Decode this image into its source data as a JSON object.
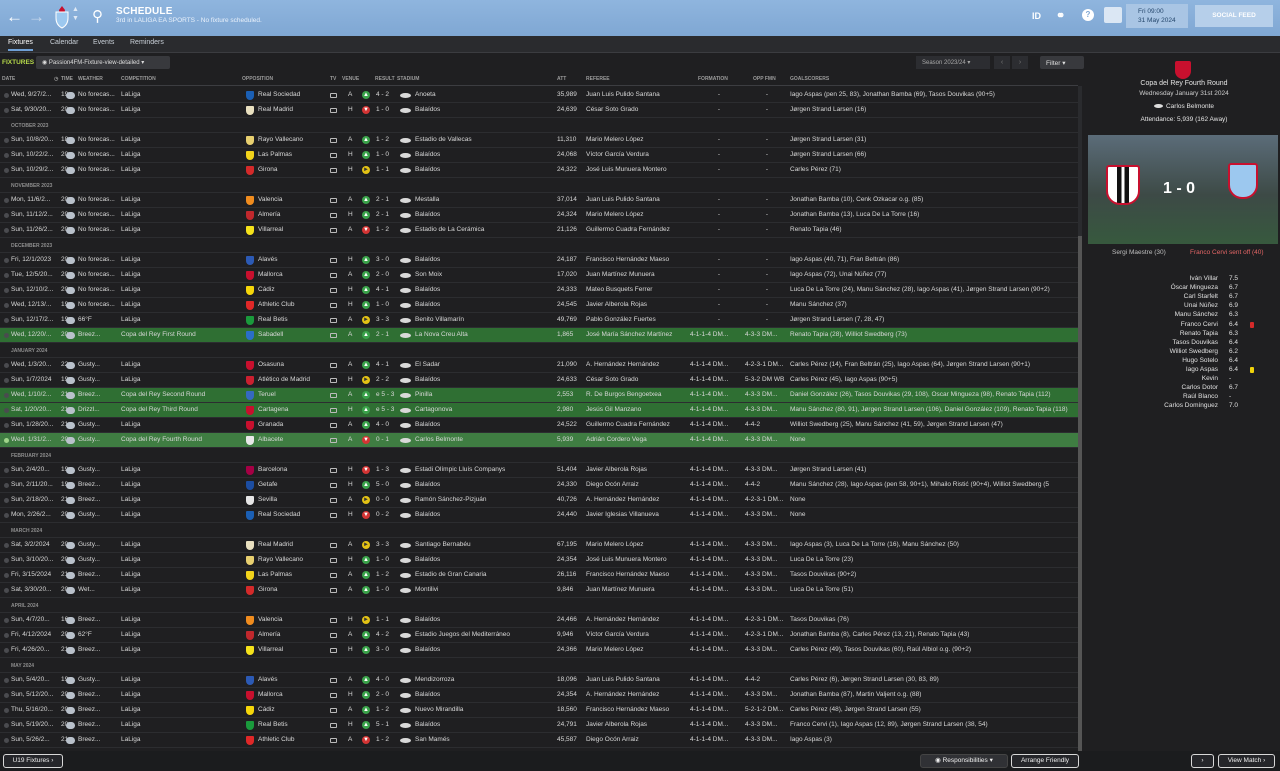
{
  "header": {
    "title": "SCHEDULE",
    "subtitle": "3rd in LALIGA EA SPORTS - No fixture scheduled.",
    "date_line1": "Fri 09:00",
    "date_line2": "31 May 2024",
    "social_feed": "SOCIAL FEED",
    "id_label": "ID"
  },
  "tabs": [
    "Fixtures",
    "Calendar",
    "Events",
    "Reminders"
  ],
  "toolbar": {
    "fixtures_label": "FIXTURES",
    "view": "Passion4FM-Fixture-view-detailed",
    "season": "Season 2023/24",
    "filter": "Filter"
  },
  "columns": {
    "date": "DATE",
    "time": "TIME",
    "weather": "WEATHER",
    "competition": "COMPETITION",
    "opposition": "OPPOSITION",
    "tv": "TV",
    "venue": "VENUE",
    "result": "RESULT",
    "stadium": "STADIUM",
    "att": "ATT",
    "referee": "REFEREE",
    "formation": "FORMATION",
    "opp_fmn": "OPP FMN",
    "goalscorers": "GOALSCORERS"
  },
  "rows": [
    {
      "date": "Wed, 9/27/2...",
      "time": "19:...",
      "weather": "No forecas...",
      "comp": "LaLiga",
      "opp": "Real Sociedad",
      "venue": "A",
      "res": "W",
      "score": "4 - 2",
      "stadium": "Anoeta",
      "att": "35,989",
      "ref": "Juan Luis Pulido Santana",
      "fmn": "-",
      "opp_fmn": "-",
      "scorers": "Iago Aspas (pen 25, 83), Jonathan Bamba (69), Tasos Douvikas (90+5)",
      "crest": "#1b5fb4"
    },
    {
      "date": "Sat, 9/30/20...",
      "time": "20:...",
      "weather": "No forecas...",
      "comp": "LaLiga",
      "opp": "Real Madrid",
      "venue": "H",
      "res": "L",
      "score": "1 - 0",
      "stadium": "Balaídos",
      "att": "24,639",
      "ref": "César Soto Grado",
      "fmn": "-",
      "opp_fmn": "-",
      "scorers": "Jørgen Strand Larsen (16)",
      "crest": "#e9e0c0"
    },
    {
      "section": "OCTOBER 2023"
    },
    {
      "date": "Sun, 10/8/20...",
      "time": "18:...",
      "weather": "No forecas...",
      "comp": "LaLiga",
      "opp": "Rayo Vallecano",
      "venue": "A",
      "res": "W",
      "score": "1 - 2",
      "stadium": "Estadio de Vallecas",
      "att": "11,310",
      "ref": "Mario Melero López",
      "fmn": "-",
      "opp_fmn": "-",
      "scorers": "Jørgen Strand Larsen (31)",
      "crest": "#e8d070"
    },
    {
      "date": "Sun, 10/22/2...",
      "time": "20:...",
      "weather": "No forecas...",
      "comp": "LaLiga",
      "opp": "Las Palmas",
      "venue": "H",
      "res": "W",
      "score": "1 - 0",
      "stadium": "Balaídos",
      "att": "24,068",
      "ref": "Víctor García Verdura",
      "fmn": "-",
      "opp_fmn": "-",
      "scorers": "Jørgen Strand Larsen (66)",
      "crest": "#f2d31b"
    },
    {
      "date": "Sun, 10/29/2...",
      "time": "20:...",
      "weather": "No forecas...",
      "comp": "LaLiga",
      "opp": "Girona",
      "venue": "H",
      "res": "D",
      "score": "1 - 1",
      "stadium": "Balaídos",
      "att": "24,322",
      "ref": "José Luis Munuera Montero",
      "fmn": "-",
      "opp_fmn": "-",
      "scorers": "Carles Pérez (71)",
      "crest": "#d42a2a"
    },
    {
      "section": "NOVEMBER 2023"
    },
    {
      "date": "Mon, 11/6/2...",
      "time": "20:...",
      "weather": "No forecas...",
      "comp": "LaLiga",
      "opp": "Valencia",
      "venue": "A",
      "res": "W",
      "score": "2 - 1",
      "stadium": "Mestalla",
      "att": "37,014",
      "ref": "Juan Luis Pulido Santana",
      "fmn": "-",
      "opp_fmn": "-",
      "scorers": "Jonathan Bamba (10), Cenk Özkacar o.g. (85)",
      "crest": "#f08c1e"
    },
    {
      "date": "Sun, 11/12/2...",
      "time": "20:...",
      "weather": "No forecas...",
      "comp": "LaLiga",
      "opp": "Almería",
      "venue": "H",
      "res": "W",
      "score": "2 - 1",
      "stadium": "Balaídos",
      "att": "24,324",
      "ref": "Mario Melero López",
      "fmn": "-",
      "opp_fmn": "-",
      "scorers": "Jonathan Bamba (13), Luca De La Torre (16)",
      "crest": "#c0282d"
    },
    {
      "date": "Sun, 11/26/2...",
      "time": "20:...",
      "weather": "No forecas...",
      "comp": "LaLiga",
      "opp": "Villarreal",
      "venue": "A",
      "res": "L",
      "score": "1 - 2",
      "stadium": "Estadio de La Cerámica",
      "att": "21,126",
      "ref": "Guillermo Cuadra Fernández",
      "fmn": "-",
      "opp_fmn": "-",
      "scorers": "Renato Tapia (46)",
      "crest": "#f5e21b"
    },
    {
      "section": "DECEMBER 2023"
    },
    {
      "date": "Fri, 12/1/2023",
      "time": "20:...",
      "weather": "No forecas...",
      "comp": "LaLiga",
      "opp": "Alavés",
      "venue": "H",
      "res": "W",
      "score": "3 - 0",
      "stadium": "Balaídos",
      "att": "24,187",
      "ref": "Francisco Hernández Maeso",
      "fmn": "-",
      "opp_fmn": "-",
      "scorers": "Iago Aspas (40, 71), Fran Beltrán (86)",
      "crest": "#2c5ab5"
    },
    {
      "date": "Tue, 12/5/20...",
      "time": "20:...",
      "weather": "No forecas...",
      "comp": "LaLiga",
      "opp": "Mallorca",
      "venue": "A",
      "res": "W",
      "score": "2 - 0",
      "stadium": "Son Moix",
      "att": "17,020",
      "ref": "Juan Martínez Munuera",
      "fmn": "-",
      "opp_fmn": "-",
      "scorers": "Iago Aspas (72), Unai Núñez (77)",
      "crest": "#c8102e"
    },
    {
      "date": "Sun, 12/10/2...",
      "time": "20:...",
      "weather": "No forecas...",
      "comp": "LaLiga",
      "opp": "Cádiz",
      "venue": "H",
      "res": "W",
      "score": "4 - 1",
      "stadium": "Balaídos",
      "att": "24,333",
      "ref": "Mateo Busquets Ferrer",
      "fmn": "-",
      "opp_fmn": "-",
      "scorers": "Luca De La Torre (24), Manu Sánchez (28), Iago Aspas (41), Jørgen Strand Larsen (90+2)",
      "crest": "#f5d60a"
    },
    {
      "date": "Wed, 12/13/...",
      "time": "19:...",
      "weather": "No forecas...",
      "comp": "LaLiga",
      "opp": "Athletic Club",
      "venue": "H",
      "res": "W",
      "score": "1 - 0",
      "stadium": "Balaídos",
      "att": "24,545",
      "ref": "Javier Alberola Rojas",
      "fmn": "-",
      "opp_fmn": "-",
      "scorers": "Manu Sánchez (37)",
      "crest": "#e02828"
    },
    {
      "date": "Sun, 12/17/2...",
      "time": "19:...",
      "weather": "66°F",
      "comp": "LaLiga",
      "opp": "Real Betis",
      "venue": "A",
      "res": "D",
      "score": "3 - 3",
      "stadium": "Benito Villamarín",
      "att": "49,769",
      "ref": "Pablo González Fuertes",
      "fmn": "-",
      "opp_fmn": "-",
      "scorers": "Jørgen Strand Larsen (7, 28, 47)",
      "crest": "#1a9a3c"
    },
    {
      "date": "Wed, 12/20/...",
      "time": "20:...",
      "weather": "Breez...",
      "comp": "Copa del Rey First Round",
      "opp": "Sabadell",
      "venue": "A",
      "res": "W",
      "score": "2 - 1",
      "stadium": "La Nova Creu Alta",
      "att": "1,865",
      "ref": "José María Sánchez Martínez",
      "fmn": "4-1-1-4 DM...",
      "opp_fmn": "4-3-3 DM...",
      "scorers": "Renato Tapia (28), Williot Swedberg (73)",
      "crest": "#2a6ec9",
      "cup": true
    },
    {
      "section": "JANUARY 2024"
    },
    {
      "date": "Wed, 1/3/20...",
      "time": "22:...",
      "weather": "Gusty...",
      "comp": "LaLiga",
      "opp": "Osasuna",
      "venue": "A",
      "res": "W",
      "score": "4 - 1",
      "stadium": "El Sadar",
      "att": "21,090",
      "ref": "A. Hernández Hernández",
      "fmn": "4-1-1-4 DM...",
      "opp_fmn": "4-2-3-1 DM...",
      "scorers": "Carles Pérez (14), Fran Beltrán (25), Iago Aspas (64), Jørgen Strand Larsen (90+1)",
      "crest": "#c8102e"
    },
    {
      "date": "Sun, 1/7/2024",
      "time": "19:...",
      "weather": "Gusty...",
      "comp": "LaLiga",
      "opp": "Atlético de Madrid",
      "venue": "H",
      "res": "D",
      "score": "2 - 2",
      "stadium": "Balaídos",
      "att": "24,633",
      "ref": "César Soto Grado",
      "fmn": "4-1-1-4 DM...",
      "opp_fmn": "5-3-2 DM WB",
      "scorers": "Carles Pérez (45), Iago Aspas (90+5)",
      "crest": "#cb2030"
    },
    {
      "date": "Wed, 1/10/2...",
      "time": "21:...",
      "weather": "Breez...",
      "comp": "Copa del Rey Second Round",
      "opp": "Teruel",
      "venue": "A",
      "res": "W",
      "score": "e 5 - 3",
      "stadium": "Pinilla",
      "att": "2,553",
      "ref": "R. De Burgos Bengoetxea",
      "fmn": "4-1-1-4 DM...",
      "opp_fmn": "4-3-3 DM...",
      "scorers": "Daniel González (26), Tasos Douvikas (29, 108), Óscar Mingueza (98), Renato Tapia (112)",
      "crest": "#3569c0",
      "cup": true
    },
    {
      "date": "Sat, 1/20/20...",
      "time": "21:...",
      "weather": "Drizzl...",
      "comp": "Copa del Rey Third Round",
      "opp": "Cartagena",
      "venue": "H",
      "res": "W",
      "score": "e 5 - 3",
      "stadium": "Cartagonova",
      "att": "2,980",
      "ref": "Jesús Gil Manzano",
      "fmn": "4-1-1-4 DM...",
      "opp_fmn": "4-3-3 DM...",
      "scorers": "Manu Sánchez (80, 91), Jørgen Strand Larsen (106), Daniel González (109), Renato Tapia (118)",
      "crest": "#c8102e",
      "cup": true
    },
    {
      "date": "Sun, 1/28/20...",
      "time": "21:...",
      "weather": "Gusty...",
      "comp": "LaLiga",
      "opp": "Granada",
      "venue": "A",
      "res": "W",
      "score": "4 - 0",
      "stadium": "Balaídos",
      "att": "24,522",
      "ref": "Guillermo Cuadra Fernández",
      "fmn": "4-1-1-4 DM...",
      "opp_fmn": "4-4-2",
      "scorers": "Williot Swedberg (25), Manu Sánchez (41, 59), Jørgen Strand Larsen (47)",
      "crest": "#c8102e"
    },
    {
      "date": "Wed, 1/31/2...",
      "time": "20:...",
      "weather": "Gusty...",
      "comp": "Copa del Rey Fourth Round",
      "opp": "Albacete",
      "venue": "A",
      "res": "L",
      "score": "0 - 1",
      "stadium": "Carlos Belmonte",
      "att": "5,939",
      "ref": "Adrián Cordero Vega",
      "fmn": "4-1-1-4 DM...",
      "opp_fmn": "4-3-3 DM...",
      "scorers": "None",
      "crest": "#e8e8e8",
      "cup": true,
      "selected": true
    },
    {
      "section": "FEBRUARY 2024"
    },
    {
      "date": "Sun, 2/4/20...",
      "time": "19:...",
      "weather": "Gusty...",
      "comp": "LaLiga",
      "opp": "Barcelona",
      "venue": "H",
      "res": "L",
      "score": "1 - 3",
      "stadium": "Estadi Olímpic Lluís Companys",
      "att": "51,404",
      "ref": "Javier Alberola Rojas",
      "fmn": "4-1-1-4 DM...",
      "opp_fmn": "4-3-3 DM...",
      "scorers": "Jørgen Strand Larsen (41)",
      "crest": "#a50044"
    },
    {
      "date": "Sun, 2/11/20...",
      "time": "19:...",
      "weather": "Breez...",
      "comp": "LaLiga",
      "opp": "Getafe",
      "venue": "H",
      "res": "W",
      "score": "5 - 0",
      "stadium": "Balaídos",
      "att": "24,330",
      "ref": "Diego Ocón Arraiz",
      "fmn": "4-1-1-4 DM...",
      "opp_fmn": "4-4-2",
      "scorers": "Manu Sánchez (28), Iago Aspas (pen 58, 90+1), Mihailo Ristić (90+4), Williot Swedberg (5",
      "crest": "#1c4da1"
    },
    {
      "date": "Sun, 2/18/20...",
      "time": "21:...",
      "weather": "Breez...",
      "comp": "LaLiga",
      "opp": "Sevilla",
      "venue": "A",
      "res": "D",
      "score": "0 - 0",
      "stadium": "Ramón Sánchez-Pizjuán",
      "att": "40,726",
      "ref": "A. Hernández Hernández",
      "fmn": "4-1-1-4 DM...",
      "opp_fmn": "4-2-3-1 DM...",
      "scorers": "None",
      "crest": "#e6e6e6"
    },
    {
      "date": "Mon, 2/26/2...",
      "time": "20:...",
      "weather": "Gusty...",
      "comp": "LaLiga",
      "opp": "Real Sociedad",
      "venue": "H",
      "res": "L",
      "score": "0 - 2",
      "stadium": "Balaídos",
      "att": "24,440",
      "ref": "Javier Iglesias Villanueva",
      "fmn": "4-1-1-4 DM...",
      "opp_fmn": "4-3-3 DM...",
      "scorers": "None",
      "crest": "#1b5fb4"
    },
    {
      "section": "MARCH 2024"
    },
    {
      "date": "Sat, 3/2/2024",
      "time": "20:...",
      "weather": "Gusty...",
      "comp": "LaLiga",
      "opp": "Real Madrid",
      "venue": "A",
      "res": "D",
      "score": "3 - 3",
      "stadium": "Santiago Bernabéu",
      "att": "67,195",
      "ref": "Mario Melero López",
      "fmn": "4-1-1-4 DM...",
      "opp_fmn": "4-3-3 DM...",
      "scorers": "Iago Aspas (3), Luca De La Torre (16), Manu Sánchez (50)",
      "crest": "#e9e0c0"
    },
    {
      "date": "Sun, 3/10/20...",
      "time": "20:...",
      "weather": "Gusty...",
      "comp": "LaLiga",
      "opp": "Rayo Vallecano",
      "venue": "H",
      "res": "W",
      "score": "1 - 0",
      "stadium": "Balaídos",
      "att": "24,354",
      "ref": "José Luis Munuera Montero",
      "fmn": "4-1-1-4 DM...",
      "opp_fmn": "4-3-3 DM...",
      "scorers": "Luca De La Torre (23)",
      "crest": "#e8d070"
    },
    {
      "date": "Fri, 3/15/2024",
      "time": "21:...",
      "weather": "Breez...",
      "comp": "LaLiga",
      "opp": "Las Palmas",
      "venue": "A",
      "res": "W",
      "score": "1 - 2",
      "stadium": "Estadio de Gran Canaria",
      "att": "26,116",
      "ref": "Francisco Hernández Maeso",
      "fmn": "4-1-1-4 DM...",
      "opp_fmn": "4-3-3 DM...",
      "scorers": "Tasos Douvikas (90+2)",
      "crest": "#f2d31b"
    },
    {
      "date": "Sat, 3/30/20...",
      "time": "20:...",
      "weather": "Wet...",
      "comp": "LaLiga",
      "opp": "Girona",
      "venue": "A",
      "res": "W",
      "score": "1 - 0",
      "stadium": "Montilivi",
      "att": "9,846",
      "ref": "Juan Martínez Munuera",
      "fmn": "4-1-1-4 DM...",
      "opp_fmn": "4-3-3 DM...",
      "scorers": "Luca De La Torre (51)",
      "crest": "#d42a2a"
    },
    {
      "section": "APRIL 2024"
    },
    {
      "date": "Sun, 4/7/20...",
      "time": "16:...",
      "weather": "Breez...",
      "comp": "LaLiga",
      "opp": "Valencia",
      "venue": "H",
      "res": "D",
      "score": "1 - 1",
      "stadium": "Balaídos",
      "att": "24,466",
      "ref": "A. Hernández Hernández",
      "fmn": "4-1-1-4 DM...",
      "opp_fmn": "4-2-3-1 DM...",
      "scorers": "Tasos Douvikas (76)",
      "crest": "#f08c1e"
    },
    {
      "date": "Fri, 4/12/2024",
      "time": "20:...",
      "weather": "62°F",
      "comp": "LaLiga",
      "opp": "Almería",
      "venue": "A",
      "res": "W",
      "score": "4 - 2",
      "stadium": "Estadio Juegos del Mediterráneo",
      "att": "9,946",
      "ref": "Víctor García Verdura",
      "fmn": "4-1-1-4 DM...",
      "opp_fmn": "4-2-3-1 DM...",
      "scorers": "Jonathan Bamba (8), Carles Pérez (13, 21), Renato Tapia (43)",
      "crest": "#c0282d"
    },
    {
      "date": "Fri, 4/26/20...",
      "time": "21:...",
      "weather": "Breez...",
      "comp": "LaLiga",
      "opp": "Villarreal",
      "venue": "H",
      "res": "W",
      "score": "3 - 0",
      "stadium": "Balaídos",
      "att": "24,366",
      "ref": "Mario Melero López",
      "fmn": "4-1-1-4 DM...",
      "opp_fmn": "4-3-3 DM...",
      "scorers": "Carles Pérez (49), Tasos Douvikas (60), Raúl Albiol o.g. (90+2)",
      "crest": "#f5e21b"
    },
    {
      "section": "MAY 2024"
    },
    {
      "date": "Sun, 5/4/20...",
      "time": "19:...",
      "weather": "Gusty...",
      "comp": "LaLiga",
      "opp": "Alavés",
      "venue": "A",
      "res": "W",
      "score": "4 - 0",
      "stadium": "Mendizorroza",
      "att": "18,096",
      "ref": "Juan Luis Pulido Santana",
      "fmn": "4-1-1-4 DM...",
      "opp_fmn": "4-4-2",
      "scorers": "Carles Pérez (6), Jørgen Strand Larsen (30, 83, 89)",
      "crest": "#2c5ab5"
    },
    {
      "date": "Sun, 5/12/20...",
      "time": "20:...",
      "weather": "Breez...",
      "comp": "LaLiga",
      "opp": "Mallorca",
      "venue": "H",
      "res": "W",
      "score": "2 - 0",
      "stadium": "Balaídos",
      "att": "24,354",
      "ref": "A. Hernández Hernández",
      "fmn": "4-1-1-4 DM...",
      "opp_fmn": "4-3-3 DM...",
      "scorers": "Jonathan Bamba (87), Martin Valjent o.g. (88)",
      "crest": "#c8102e"
    },
    {
      "date": "Thu, 5/16/20...",
      "time": "20:...",
      "weather": "Breez...",
      "comp": "LaLiga",
      "opp": "Cádiz",
      "venue": "A",
      "res": "W",
      "score": "1 - 2",
      "stadium": "Nuevo Mirandilla",
      "att": "18,560",
      "ref": "Francisco Hernández Maeso",
      "fmn": "4-1-1-4 DM...",
      "opp_fmn": "5-2-1-2 DM...",
      "scorers": "Carles Pérez (48), Jørgen Strand Larsen (55)",
      "crest": "#f5d60a"
    },
    {
      "date": "Sun, 5/19/20...",
      "time": "20:...",
      "weather": "Breez...",
      "comp": "LaLiga",
      "opp": "Real Betis",
      "venue": "H",
      "res": "W",
      "score": "5 - 1",
      "stadium": "Balaídos",
      "att": "24,791",
      "ref": "Javier Alberola Rojas",
      "fmn": "4-1-1-4 DM...",
      "opp_fmn": "4-3-3 DM...",
      "scorers": "Franco Cervi (1), Iago Aspas (12, 89), Jørgen Strand Larsen (38, 54)",
      "crest": "#1a9a3c"
    },
    {
      "date": "Sun, 5/26/2...",
      "time": "21:...",
      "weather": "Breez...",
      "comp": "LaLiga",
      "opp": "Athletic Club",
      "venue": "A",
      "res": "L",
      "score": "1 - 2",
      "stadium": "San Mamés",
      "att": "45,587",
      "ref": "Diego Ocón Arraiz",
      "fmn": "4-1-1-4 DM...",
      "opp_fmn": "4-3-3 DM...",
      "scorers": "Iago Aspas (3)",
      "crest": "#e02828"
    }
  ],
  "match_panel": {
    "competition": "Copa del Rey Fourth Round",
    "date": "Wednesday January 31st 2024",
    "stadium": "Carlos Belmonte",
    "attendance": "Attendance: 5,939 (162 Away)",
    "score": "1 - 0",
    "event_home": "Sergi Maestre (30)",
    "event_away": "Franco Cervi sent off (40)",
    "ratings": [
      {
        "name": "Iván Villar",
        "rating": "7.5"
      },
      {
        "name": "Óscar Mingueza",
        "rating": "6.7"
      },
      {
        "name": "Carl Starfelt",
        "rating": "6.7"
      },
      {
        "name": "Unai Núñez",
        "rating": "6.9"
      },
      {
        "name": "Manu Sánchez",
        "rating": "6.3"
      },
      {
        "name": "Franco Cervi",
        "rating": "6.4",
        "card": "red"
      },
      {
        "name": "Renato Tapia",
        "rating": "6.3"
      },
      {
        "name": "Tasos Douvikas",
        "rating": "6.4"
      },
      {
        "name": "Williot Swedberg",
        "rating": "6.2"
      },
      {
        "name": "Hugo Sotelo",
        "rating": "6.4"
      },
      {
        "name": "Iago Aspas",
        "rating": "6.4",
        "card": "yellow"
      },
      {
        "name": "Kevin",
        "rating": "-"
      },
      {
        "name": "Carlos Dotor",
        "rating": "6.7"
      },
      {
        "name": "Raúl Blanco",
        "rating": "-"
      },
      {
        "name": "Carlos Domínguez",
        "rating": "7.0"
      }
    ]
  },
  "bottom": {
    "u19": "U19 Fixtures",
    "responsibilities": "Responsibilities",
    "arrange": "Arrange Friendly",
    "view_match": "View Match"
  },
  "colors": {
    "topbar": "#8fb5de",
    "cup_row": "#2f6f33",
    "win": "#3aa24a",
    "draw": "#e3c215",
    "loss": "#d43434"
  }
}
